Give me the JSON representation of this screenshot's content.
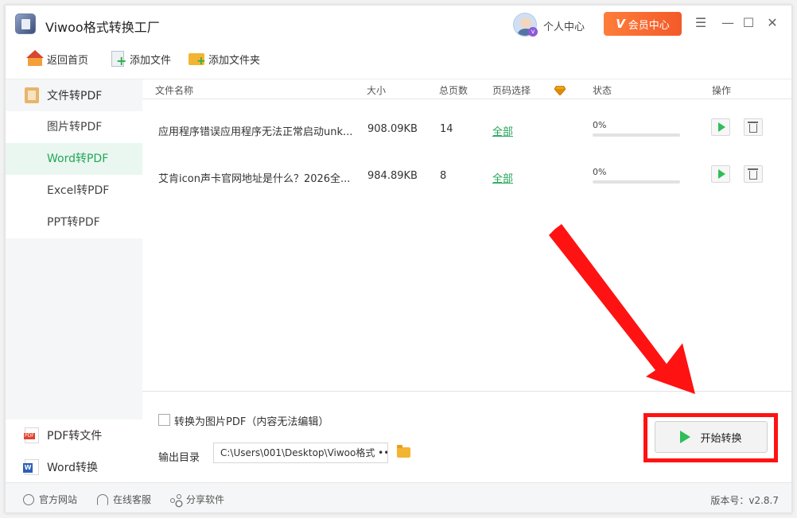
{
  "app": {
    "title": "Viwoo格式转换工厂"
  },
  "header": {
    "personal_center": "个人中心",
    "vip_badge": "v",
    "vip_letter": "V",
    "vip_label": "会员中心"
  },
  "toolbar": {
    "home": "返回首页",
    "add_file": "添加文件",
    "add_folder": "添加文件夹"
  },
  "sidebar": {
    "category": "文件转PDF",
    "items": [
      {
        "label": "图片转PDF",
        "active": false
      },
      {
        "label": "Word转PDF",
        "active": true
      },
      {
        "label": "Excel转PDF",
        "active": false
      },
      {
        "label": "PPT转PDF",
        "active": false
      }
    ],
    "bottom": [
      {
        "label": "PDF转文件",
        "icon": "pdf-file-icon"
      },
      {
        "label": "Word转换",
        "icon": "word-icon"
      }
    ]
  },
  "table": {
    "headers": {
      "name": "文件名称",
      "size": "大小",
      "pages": "总页数",
      "page_select": "页码选择",
      "status": "状态",
      "action": "操作"
    },
    "rows": [
      {
        "name": "应用程序错误应用程序无法正常启动unk...",
        "size": "908.09KB",
        "pages": "14",
        "page_select": "全部",
        "progress_text": "0%",
        "progress": 0
      },
      {
        "name": "艾肯icon声卡官网地址是什么？2026全...",
        "size": "984.89KB",
        "pages": "8",
        "page_select": "全部",
        "progress_text": "0%",
        "progress": 0
      }
    ]
  },
  "bottom": {
    "image_pdf_label": "转换为图片PDF（内容无法编辑）",
    "output_label": "输出目录",
    "output_path": "C:\\Users\\001\\Desktop\\Viwoo格式 •••",
    "start_label": "开始转换"
  },
  "statusbar": {
    "website": "官方网站",
    "support": "在线客服",
    "share": "分享软件",
    "version": "版本号：v2.8.7"
  },
  "colors": {
    "accent": "#23a659",
    "vip": "#f25a2a",
    "annotation": "#ff1212"
  }
}
